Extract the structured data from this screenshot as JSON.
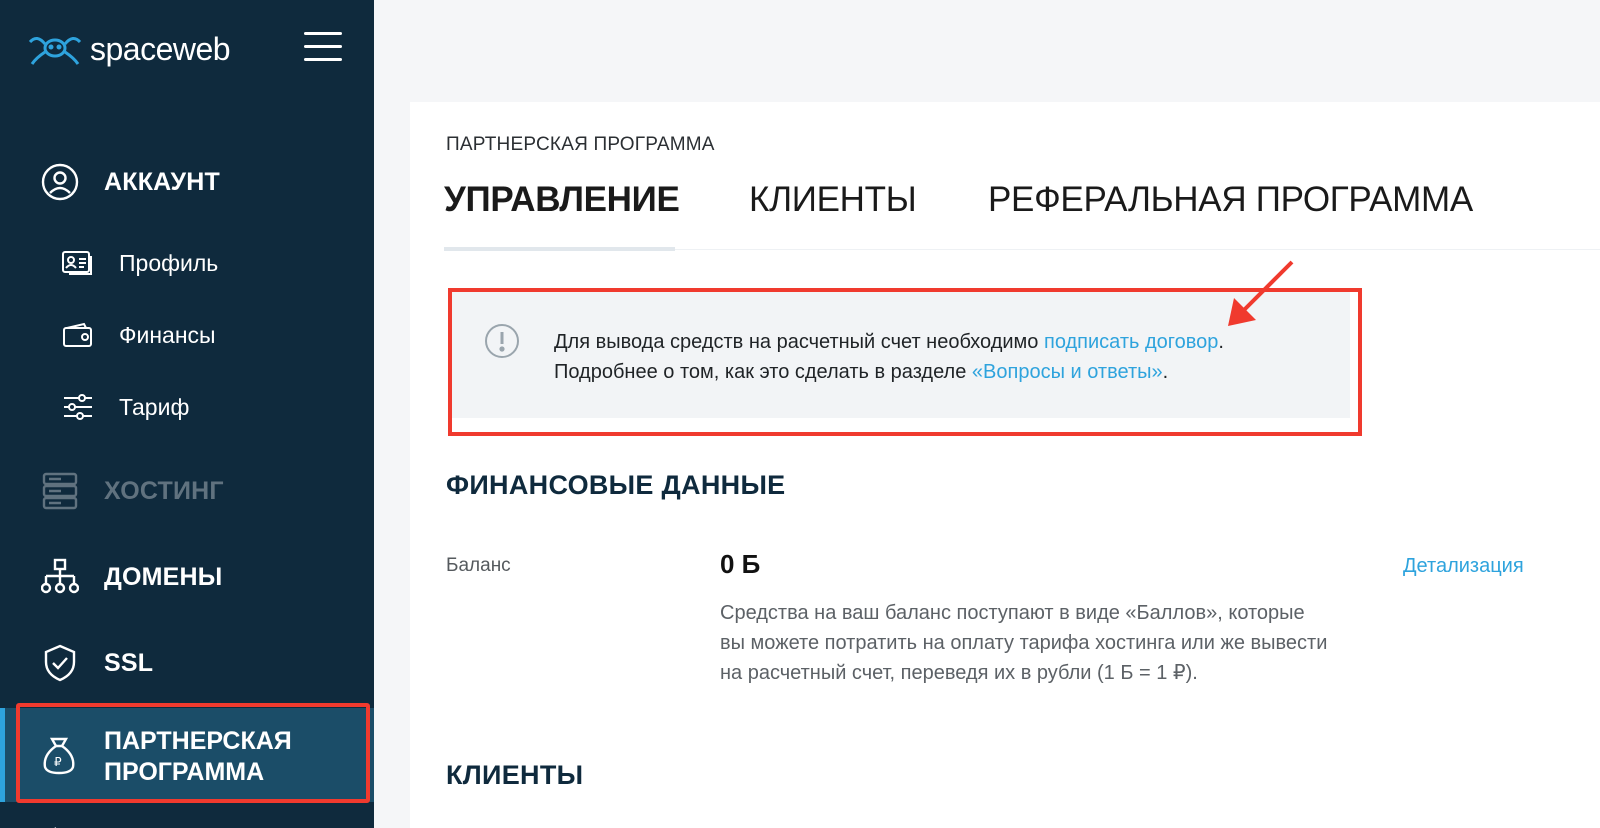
{
  "sidebar": {
    "logo_text": "spaceweb",
    "items": [
      {
        "label": "АККАУНТ",
        "icon": "user-circle-icon"
      },
      {
        "label": "Профиль",
        "icon": "id-card-icon"
      },
      {
        "label": "Финансы",
        "icon": "wallet-icon"
      },
      {
        "label": "Тариф",
        "icon": "sliders-icon"
      },
      {
        "label": "ХОСТИНГ",
        "icon": "server-icon"
      },
      {
        "label": "ДОМЕНЫ",
        "icon": "sitemap-icon"
      },
      {
        "label": "SSL",
        "icon": "shield-check-icon"
      },
      {
        "label_line1": "ПАРТНЕРСКАЯ",
        "label_line2": "ПРОГРАММА",
        "icon": "money-bag-icon"
      }
    ]
  },
  "main": {
    "kicker": "ПАРТНЕРСКАЯ ПРОГРАММА",
    "tabs": [
      {
        "label": "УПРАВЛЕНИЕ"
      },
      {
        "label": "КЛИЕНТЫ"
      },
      {
        "label": "РЕФЕРАЛЬНАЯ ПРОГРАММА"
      }
    ],
    "notice": {
      "line1_text": "Для вывода средств на расчетный счет необходимо ",
      "line1_link": "подписать договор",
      "line1_end": ".",
      "line2_text": "Подробнее о том, как это сделать в разделе ",
      "line2_link": "«Вопросы и ответы»",
      "line2_end": "."
    },
    "finance": {
      "heading": "ФИНАНСОВЫЕ ДАННЫЕ",
      "balance_label": "Баланс",
      "balance_value": "0 Б",
      "details_link": "Детализация",
      "desc_line1": "Средства на ваш баланс поступают в виде «Баллов», которые",
      "desc_line2": "вы можете потратить на оплату тарифа хостинга или же вывести",
      "desc_line3": "на расчетный счет, переведя их в рубли (1 Б = 1 ₽)."
    },
    "clients_heading": "КЛИЕНТЫ"
  },
  "colors": {
    "sidebar_bg": "#0f2a3d",
    "active_bg": "#1b4d68",
    "accent": "#2ea3dd",
    "annotation": "#f03a2e"
  }
}
